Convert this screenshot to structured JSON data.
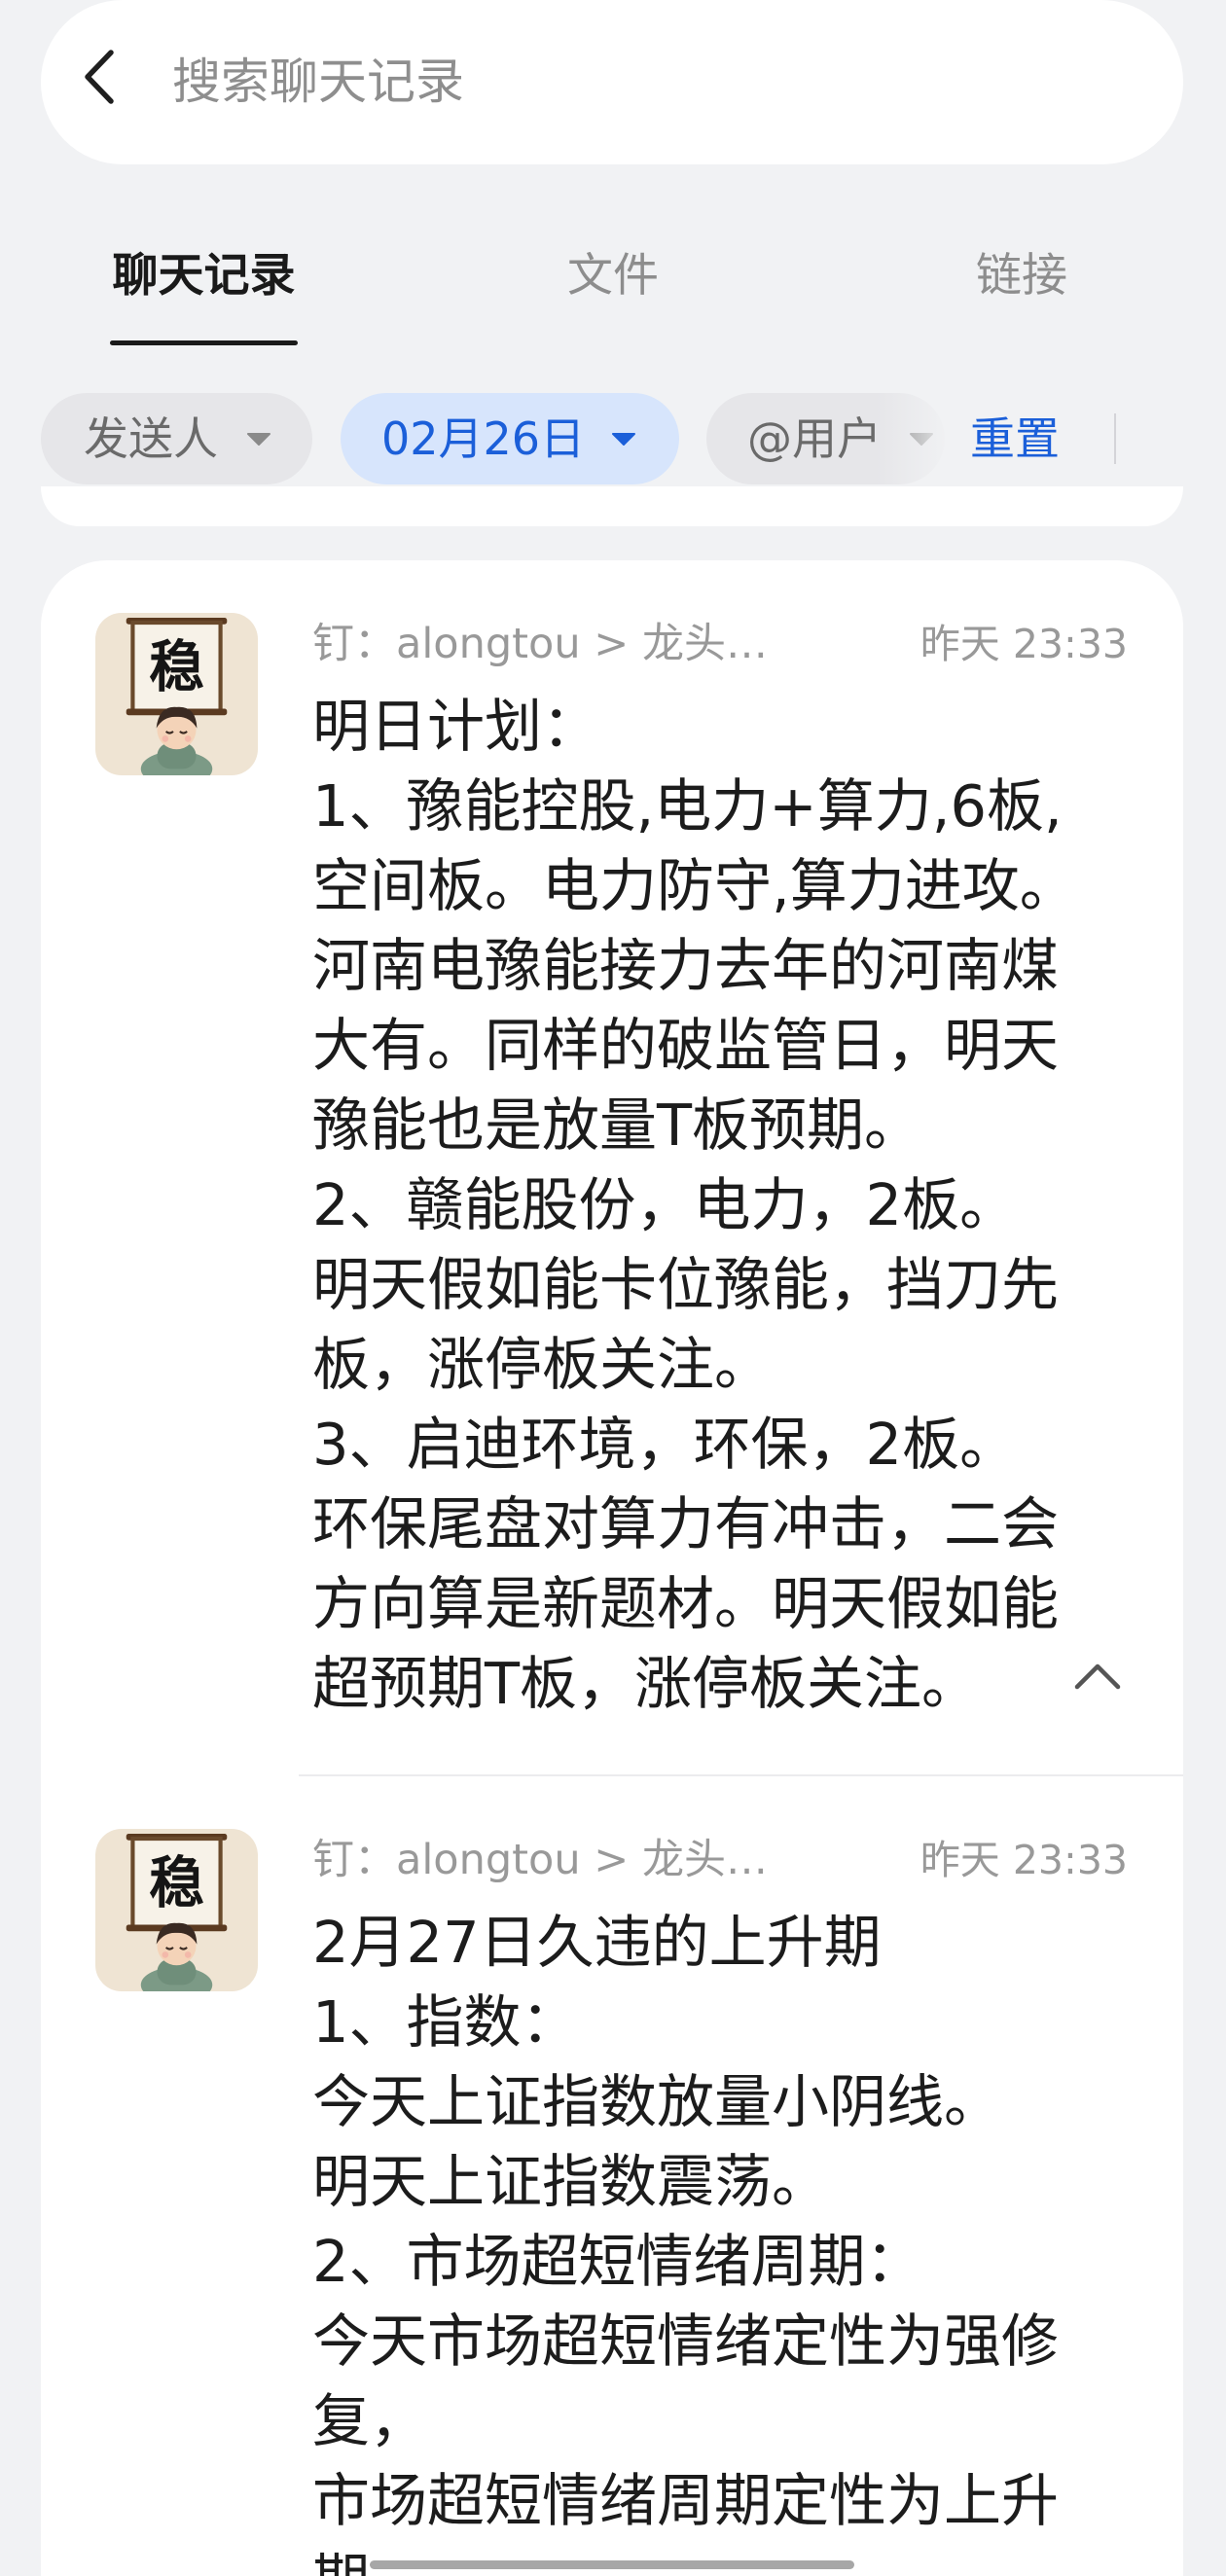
{
  "search": {
    "placeholder": "搜索聊天记录"
  },
  "tabs": [
    {
      "label": "聊天记录",
      "active": true
    },
    {
      "label": "文件",
      "active": false
    },
    {
      "label": "链接",
      "active": false
    }
  ],
  "filters": {
    "sender": {
      "label": "发送人",
      "selected": false
    },
    "date": {
      "label": "02月26日",
      "selected": true
    },
    "mention": {
      "label": "@用户",
      "selected": false
    },
    "reset_label": "重置"
  },
  "messages": [
    {
      "avatar_text": "稳",
      "sender": "钉：alongtou > 龙头…",
      "time": "昨天 23:33",
      "lines": [
        "明日计划：",
        "1、豫能控股,电力+算力,6板,",
        "空间板。电力防守,算力进攻。",
        "河南电豫能接力去年的河南煤",
        "大有。同样的破监管日，明天",
        "豫能也是放量T板预期。",
        "2、赣能股份，电力，2板。",
        "明天假如能卡位豫能，挡刀先",
        "板，涨停板关注。",
        "3、启迪环境，环保，2板。",
        "环保尾盘对算力有冲击，二会",
        "方向算是新题材。明天假如能",
        "超预期T板，涨停板关注。"
      ],
      "collapse_icon": "chevron-up-icon"
    },
    {
      "avatar_text": "稳",
      "sender": "钉：alongtou > 龙头…",
      "time": "昨天 23:33",
      "lines": [
        "2月27日久违的上升期",
        "1、指数：",
        "今天上证指数放量小阴线。",
        "明天上证指数震荡。",
        "2、市场超短情绪周期：",
        "今天市场超短情绪定性为强修",
        "复，",
        "市场超短情绪周期定性为上升",
        "期"
      ]
    }
  ],
  "icons": {
    "back": "chevron-left-icon",
    "filter_caret": "caret-down-icon",
    "collapse": "chevron-up-icon"
  },
  "colors": {
    "page_bg": "#f1f2f4",
    "text_primary": "#1c1c1c",
    "accent": "#1b5fd9",
    "chip_bg": "#e6e6e9",
    "chip_selected_bg": "#d7e5fc"
  }
}
